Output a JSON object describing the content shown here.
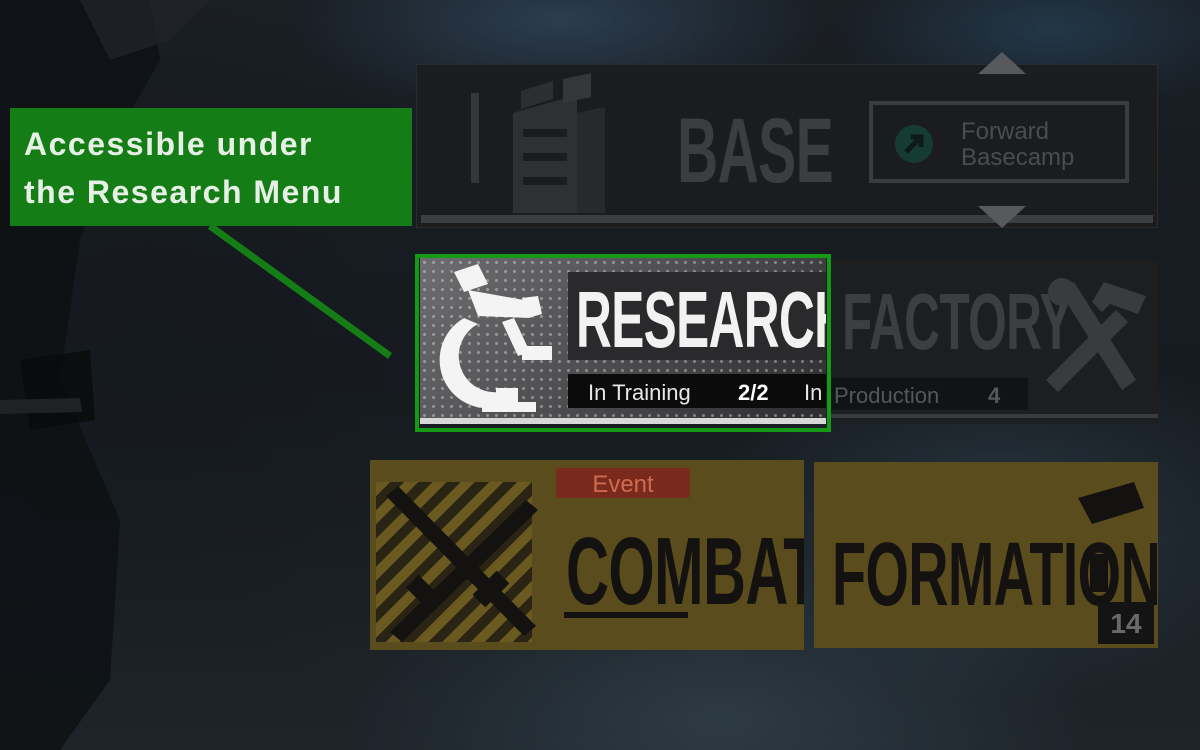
{
  "annotation": {
    "text": "Accessible under\nthe Research Menu",
    "color": "#157d15"
  },
  "menu": {
    "base": {
      "label": "BASE",
      "forward_basecamp": "Forward\nBasecamp",
      "icon": "forward-arrow-icon"
    },
    "research": {
      "label": "RESEARCH",
      "status_label": "In Training",
      "status_count": "2/2",
      "status_more": "In",
      "icon": "microscope-icon",
      "highlight_color": "#149a14"
    },
    "factory": {
      "label": "FACTORY",
      "status_label": "Production",
      "status_count": "4",
      "icon": "hammer-wrench-icon"
    },
    "combat": {
      "label": "COMBAT",
      "event_tag": "Event",
      "icon": "rifles-icon"
    },
    "formation": {
      "label": "FORMATION",
      "count": "14",
      "icon": "flag-icon"
    }
  }
}
